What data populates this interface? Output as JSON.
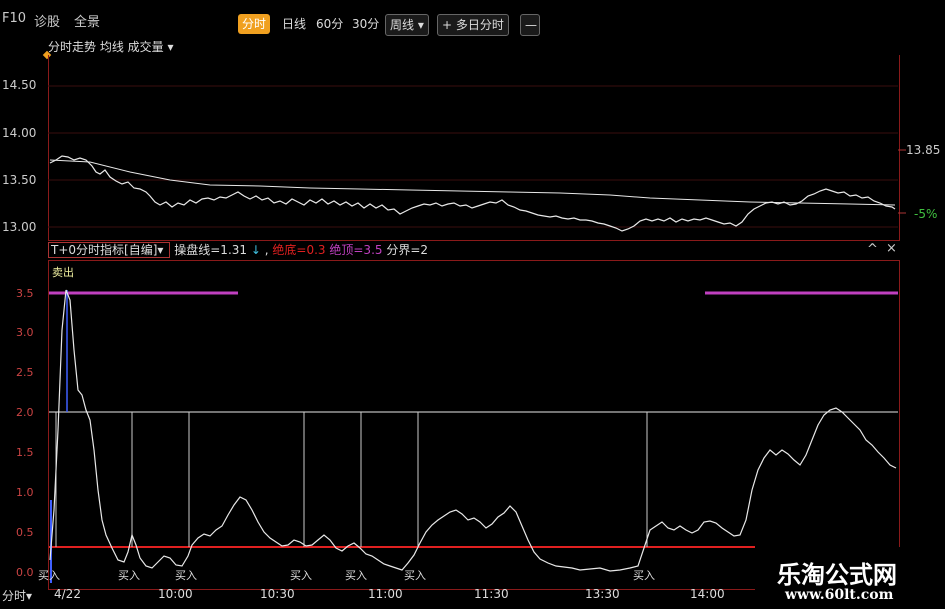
{
  "toolbar": {
    "f10": "F10",
    "diagnose": "诊股",
    "panorama": "全景",
    "tabs": [
      "分时",
      "日线",
      "60分",
      "30分"
    ],
    "weekly": "周线",
    "multi_day": "多日分时",
    "plus": "+",
    "arrow": "▾",
    "dash": "—"
  },
  "subtitle": "分时走势 均线 成交量 ▾",
  "price_axis": {
    "labels": [
      "14.50",
      "14.00",
      "13.50",
      "13.00"
    ],
    "right_price": "13.85",
    "right_pct": "-5%"
  },
  "indicator_bar": {
    "title": "T+0分时指标[自编]",
    "dropdown": "▾",
    "main_line": "操盘线=1.31",
    "down_arrow": "↓",
    "comma": ",",
    "bottom": "绝底=0.3",
    "top": "绝顶=3.5",
    "boundary": "分界=2",
    "ctl_up": "^",
    "ctl_close": "×"
  },
  "indicator_axis": {
    "labels": [
      "3.5",
      "3.0",
      "2.5",
      "2.0",
      "1.5",
      "1.0",
      "0.5",
      "0.0"
    ]
  },
  "signals": {
    "sell": "卖出",
    "buy": "买入"
  },
  "time_axis": {
    "mode": "分时",
    "mode_arrow": "▾",
    "date": "4/22",
    "times": [
      "10:00",
      "10:30",
      "11:00",
      "11:30",
      "13:30",
      "14:00"
    ]
  },
  "watermark": {
    "name": "乐淘公式网",
    "url": "www.60lt.com"
  },
  "colors": {
    "accent": "#f0a020",
    "frame": "#8a1a1a",
    "red_line": "#e02020",
    "magenta": "#c040c0",
    "white_line": "#ffffff",
    "cyan": "#40c0e0"
  }
}
